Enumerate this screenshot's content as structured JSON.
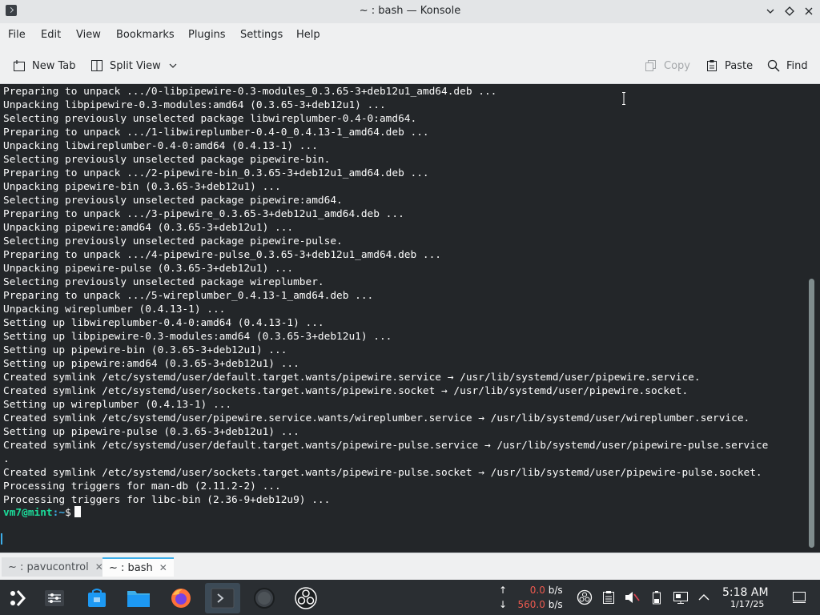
{
  "window": {
    "title": "~ : bash — Konsole"
  },
  "menu": {
    "file": "File",
    "edit": "Edit",
    "view": "View",
    "bookmarks": "Bookmarks",
    "plugins": "Plugins",
    "settings": "Settings",
    "help": "Help"
  },
  "toolbar": {
    "new_tab": "New Tab",
    "split_view": "Split View",
    "copy": "Copy",
    "paste": "Paste",
    "find": "Find"
  },
  "terminal": {
    "lines": [
      "Preparing to unpack .../0-libpipewire-0.3-modules_0.3.65-3+deb12u1_amd64.deb ...",
      "Unpacking libpipewire-0.3-modules:amd64 (0.3.65-3+deb12u1) ...",
      "Selecting previously unselected package libwireplumber-0.4-0:amd64.",
      "Preparing to unpack .../1-libwireplumber-0.4-0_0.4.13-1_amd64.deb ...",
      "Unpacking libwireplumber-0.4-0:amd64 (0.4.13-1) ...",
      "Selecting previously unselected package pipewire-bin.",
      "Preparing to unpack .../2-pipewire-bin_0.3.65-3+deb12u1_amd64.deb ...",
      "Unpacking pipewire-bin (0.3.65-3+deb12u1) ...",
      "Selecting previously unselected package pipewire:amd64.",
      "Preparing to unpack .../3-pipewire_0.3.65-3+deb12u1_amd64.deb ...",
      "Unpacking pipewire:amd64 (0.3.65-3+deb12u1) ...",
      "Selecting previously unselected package pipewire-pulse.",
      "Preparing to unpack .../4-pipewire-pulse_0.3.65-3+deb12u1_amd64.deb ...",
      "Unpacking pipewire-pulse (0.3.65-3+deb12u1) ...",
      "Selecting previously unselected package wireplumber.",
      "Preparing to unpack .../5-wireplumber_0.4.13-1_amd64.deb ...",
      "Unpacking wireplumber (0.4.13-1) ...",
      "Setting up libwireplumber-0.4-0:amd64 (0.4.13-1) ...",
      "Setting up libpipewire-0.3-modules:amd64 (0.3.65-3+deb12u1) ...",
      "Setting up pipewire-bin (0.3.65-3+deb12u1) ...",
      "Setting up pipewire:amd64 (0.3.65-3+deb12u1) ...",
      "Created symlink /etc/systemd/user/default.target.wants/pipewire.service → /usr/lib/systemd/user/pipewire.service.",
      "Created symlink /etc/systemd/user/sockets.target.wants/pipewire.socket → /usr/lib/systemd/user/pipewire.socket.",
      "Setting up wireplumber (0.4.13-1) ...",
      "Created symlink /etc/systemd/user/pipewire.service.wants/wireplumber.service → /usr/lib/systemd/user/wireplumber.service.",
      "Setting up pipewire-pulse (0.3.65-3+deb12u1) ...",
      "Created symlink /etc/systemd/user/default.target.wants/pipewire-pulse.service → /usr/lib/systemd/user/pipewire-pulse.service",
      ".",
      "Created symlink /etc/systemd/user/sockets.target.wants/pipewire-pulse.socket → /usr/lib/systemd/user/pipewire-pulse.socket.",
      "Processing triggers for man-db (2.11.2-2) ...",
      "Processing triggers for libc-bin (2.36-9+deb12u9) ..."
    ],
    "prompt_user": "vm7@mint",
    "prompt_path": ":~",
    "prompt_symbol": "$"
  },
  "tabs": [
    {
      "label": "~ : pavucontrol",
      "active": false
    },
    {
      "label": "~ : bash",
      "active": true
    }
  ],
  "taskbar": {
    "net_up_arrow": "↑",
    "net_up": "0.0",
    "net_down_arrow": "↓",
    "net_down": "560.0",
    "net_unit": "b/s",
    "time": "5:18 AM",
    "date": "1/17/25",
    "apps": [
      "app-launcher-icon",
      "system-settings-icon",
      "discover-store-icon",
      "file-manager-icon",
      "firefox-icon",
      "konsole-icon",
      "app-circle-icon",
      "obs-studio-icon"
    ]
  },
  "colors": {
    "terminal_bg": "#232629",
    "prompt_user": "#1cdc9a",
    "prompt_path": "#3daee9",
    "accent": "#3daee9",
    "net_value": "#ed5a4f"
  }
}
